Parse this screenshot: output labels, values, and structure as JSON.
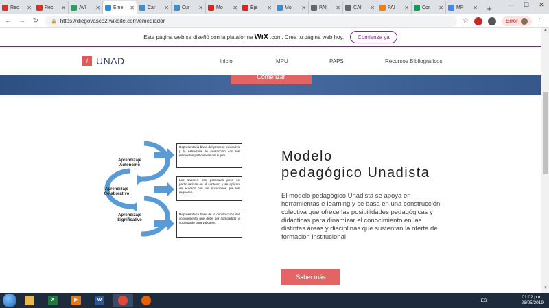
{
  "browser": {
    "tabs": [
      {
        "label": "Rec",
        "icon": "gmail-icon",
        "color": "#d93025"
      },
      {
        "label": "Rec",
        "icon": "gmail-icon",
        "color": "#d93025"
      },
      {
        "label": "AVI",
        "icon": "drive-icon",
        "color": "#1fa463"
      },
      {
        "label": "Eme",
        "icon": "wix-icon",
        "color": "#2f8fd5",
        "active": true
      },
      {
        "label": "Car",
        "icon": "unad-icon",
        "color": "#3a8fd1"
      },
      {
        "label": "Cur",
        "icon": "unad-icon",
        "color": "#3a8fd1"
      },
      {
        "label": "Mo",
        "icon": "youtube-icon",
        "color": "#e62117"
      },
      {
        "label": "Eje",
        "icon": "youtube-icon",
        "color": "#e62117"
      },
      {
        "label": "Mo",
        "icon": "unad-icon",
        "color": "#3a8fd1"
      },
      {
        "label": "PAI",
        "icon": "globe-icon",
        "color": "#666666"
      },
      {
        "label": "CAI",
        "icon": "globe-icon",
        "color": "#666666"
      },
      {
        "label": "PAI",
        "icon": "blogger-icon",
        "color": "#f57d00"
      },
      {
        "label": "Cor",
        "icon": "sheets-icon",
        "color": "#0f9d58"
      },
      {
        "label": "MP",
        "icon": "google-icon",
        "color": "#4285f4"
      }
    ],
    "new_tab": "+",
    "url": "https://diegovasco2.wixsite.com/emediador",
    "error_label": "Error"
  },
  "wix_banner": {
    "text_before": "Este página web se diseñó con la plataforma",
    "brand": "WiX",
    "text_after": ".com. Crea tu página web hoy.",
    "cta": "Comienza ya"
  },
  "site": {
    "logo_glyph": "/",
    "logo_text": "UNAD",
    "menu": [
      "Inicio",
      "MPU",
      "PAPS",
      "Recursos Bibliograficos"
    ],
    "hero_button": "Comenzar"
  },
  "content": {
    "heading_line1": "Modelo",
    "heading_line2": "pedagógico Unadista",
    "paragraph": "El modelo pedagógico Unadista se apoya en herramientas  e-learning y se basa en una construcción colectiva que ofrece las posibilidades pedagógicas y didácticas para dinamizar el conocimiento en las distintas áreas y disciplinas que sustentan la oferta de formación institucional",
    "button": "Saber más"
  },
  "diagram": {
    "stages": [
      {
        "label": "Aprendizaje Autonomo",
        "text": "Representa la base del proceso educativo y la estructura de interacción con los elementos particulares del sujeto."
      },
      {
        "label": "Aprendizaje Colaborativo",
        "text": "Los saberes son generales pero se particularizan en el contexto y se aplican de acuerdo con las situaciones que los requieren."
      },
      {
        "label": "Aprendizaje Significativo",
        "text": "Representa la base de la construcción del conocimiento que debe ser compartido y socializado para validarse."
      }
    ]
  },
  "taskbar": {
    "apps": [
      {
        "name": "explorer-icon",
        "color": "#e8b84a"
      },
      {
        "name": "excel-icon",
        "color": "#1d7a3e",
        "glyph": "X"
      },
      {
        "name": "media-icon",
        "color": "#e07b1a",
        "glyph": "▶"
      },
      {
        "name": "word-icon",
        "color": "#2b5797",
        "glyph": "W"
      },
      {
        "name": "chrome-icon",
        "color": "#dd4b39",
        "glyph": "",
        "active": true
      },
      {
        "name": "firefox-icon",
        "color": "#e66000",
        "glyph": ""
      }
    ],
    "lang": "ES",
    "time": "01:02 p.m.",
    "date": "26/05/2019"
  }
}
